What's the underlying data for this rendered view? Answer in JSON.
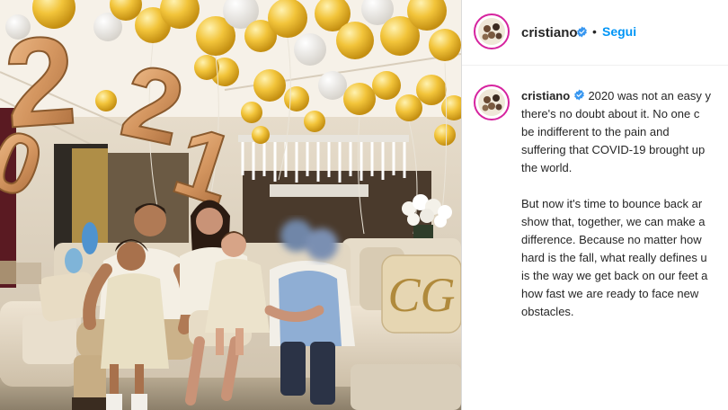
{
  "post": {
    "username": "cristiano",
    "follow_label": "Segui",
    "separator": "•",
    "caption_paragraphs": [
      [
        "2020 was not an easy y",
        "there's no doubt about it. No one c",
        "be indifferent to the pain and",
        "suffering that COVID-19 brought up",
        "the world."
      ],
      [
        "But now it's time to bounce back ar",
        "show that, together, we can make a",
        "difference. Because no matter how",
        "hard is the fall, what really defines u",
        "is the way we get back on our feet a",
        "how fast we are ready to face new",
        "obstacles."
      ]
    ]
  },
  "photo": {
    "balloon_digits": [
      "2",
      "0",
      "2",
      "1"
    ],
    "pillow_monogram": "CG"
  },
  "colors": {
    "follow_blue": "#0095f6",
    "verified_blue": "#3897f0",
    "text": "#262626",
    "balloon_gold": "#e8b94a",
    "balloon_rose_gold": "#d9a06a"
  }
}
